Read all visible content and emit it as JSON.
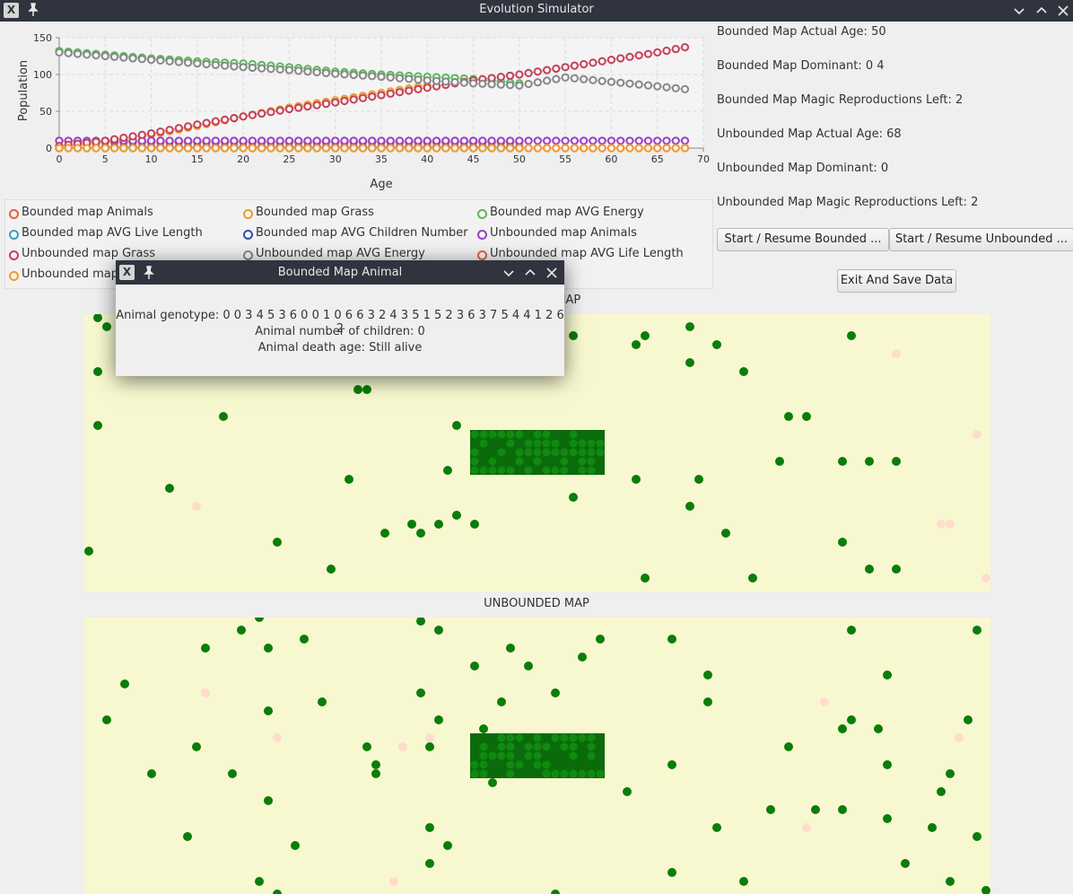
{
  "window": {
    "title": "Evolution Simulator"
  },
  "chart_data": {
    "type": "line",
    "xlabel": "Age",
    "ylabel": "Population",
    "xlim": [
      0,
      70
    ],
    "ylim": [
      0,
      150
    ],
    "x_ticks": [
      0,
      5,
      10,
      15,
      20,
      25,
      30,
      35,
      40,
      45,
      50,
      55,
      60,
      65,
      70
    ],
    "y_ticks": [
      0,
      50,
      100,
      150
    ],
    "grid": true,
    "legend_position": "bottom",
    "series": [
      {
        "name": "Bounded map Animals",
        "color": "#e8613c",
        "x": [
          0,
          2,
          5,
          8,
          10,
          15,
          20,
          25,
          30,
          35,
          40,
          45,
          50
        ],
        "values": [
          10,
          8,
          8,
          8,
          8,
          8,
          8,
          8,
          8,
          8,
          8,
          8,
          8
        ]
      },
      {
        "name": "Bounded map Grass",
        "color": "#f09a30",
        "x": [
          0,
          5,
          10,
          15,
          20,
          25,
          30,
          35,
          40
        ],
        "values": [
          0,
          8,
          18,
          30,
          43,
          55,
          65,
          75,
          85
        ]
      },
      {
        "name": "Bounded map AVG Energy",
        "color": "#5cb85c",
        "x": [
          0,
          5,
          10,
          15,
          20,
          25,
          30,
          35,
          40,
          45,
          50
        ],
        "values": [
          132,
          127,
          122,
          118,
          115,
          110,
          104,
          100,
          97,
          94,
          88
        ]
      },
      {
        "name": "Bounded map AVG Live Length",
        "color": "#3aa0b8",
        "x": [
          0,
          50
        ],
        "values": [
          0,
          0
        ]
      },
      {
        "name": "Bounded map AVG Children Number",
        "color": "#3050b0",
        "x": [
          0,
          5,
          10,
          20,
          30,
          40,
          50
        ],
        "values": [
          0,
          1,
          1,
          1,
          1,
          1,
          1
        ]
      },
      {
        "name": "Unbounded map Animals",
        "color": "#9a40c8",
        "x": [
          0,
          10,
          20,
          30,
          40,
          50,
          60,
          68
        ],
        "values": [
          10,
          10,
          10,
          10,
          10,
          10,
          10,
          10
        ]
      },
      {
        "name": "Unbounded map Grass",
        "color": "#c8405a",
        "x": [
          0,
          5,
          10,
          15,
          20,
          25,
          30,
          35,
          40,
          45,
          50,
          55,
          60,
          65,
          68
        ],
        "values": [
          3,
          10,
          20,
          32,
          43,
          53,
          62,
          72,
          82,
          92,
          100,
          110,
          120,
          130,
          137
        ]
      },
      {
        "name": "Unbounded map AVG Energy",
        "color": "#888888",
        "x": [
          0,
          5,
          10,
          15,
          20,
          25,
          30,
          35,
          40,
          45,
          50,
          55,
          60,
          65,
          68
        ],
        "values": [
          130,
          125,
          120,
          115,
          110,
          106,
          101,
          97,
          92,
          88,
          85,
          96,
          90,
          84,
          80
        ]
      },
      {
        "name": "Unbounded map AVG Life Length",
        "color": "#e8613c",
        "x": [
          0,
          68
        ],
        "values": [
          0,
          0
        ]
      },
      {
        "name": "Unbounded map AVG Children Number",
        "color": "#f09a30",
        "x": [
          0,
          68
        ],
        "values": [
          0,
          0
        ]
      }
    ]
  },
  "legend": {
    "items": [
      {
        "label": "Bounded map Animals",
        "color": "#e8613c"
      },
      {
        "label": "Bounded map Grass",
        "color": "#f09a30"
      },
      {
        "label": "Bounded map AVG Energy",
        "color": "#5cb85c"
      },
      {
        "label": "Bounded map AVG Live Length",
        "color": "#3aa0b8"
      },
      {
        "label": "Bounded map AVG Children Number",
        "color": "#3050b0"
      },
      {
        "label": "Unbounded map Animals",
        "color": "#9a40c8"
      },
      {
        "label": "Unbounded map Grass",
        "color": "#c8405a"
      },
      {
        "label": "Unbounded map AVG Energy",
        "color": "#888888"
      },
      {
        "label": "Unbounded map AVG Life Length",
        "color": "#e8613c"
      },
      {
        "label": "Unbounded map",
        "color": "#f09a30"
      }
    ]
  },
  "stats": {
    "bounded_age": "Bounded Map Actual Age: 50",
    "bounded_dominant": "Bounded Map Dominant: 0 4",
    "bounded_magic": "Bounded Map Magic Reproductions Left: 2",
    "unbounded_age": "Unbounded Map Actual Age: 68",
    "unbounded_dominant": "Unbounded Map Dominant: 0",
    "unbounded_magic": "Unbounded Map Magic Reproductions Left: 2"
  },
  "buttons": {
    "start_bounded": "Start / Resume Bounded ...",
    "start_unbounded": "Start / Resume Unbounded ...",
    "exit_save": "Exit And Save Data"
  },
  "maps": {
    "bounded_title": "BOUNDED MAP",
    "unbounded_title": "UNBOUNDED MAP",
    "colors": {
      "animal": "#0a7d0a",
      "plant": "#ffdccc",
      "jungle": "#0b6b0b",
      "steppe": "#f8f8d0"
    }
  },
  "popup": {
    "title": "Bounded Map Animal",
    "genotype": "Animal genotype: 0 0 3 4 5 3 6 0 0 1 0 6 6 3 2 4 3 5 1 5 2 3 6 3 7 5 4 4 1 2 6 2",
    "children": "Animal number of children: 0",
    "death_age": "Animal death age: Still alive"
  }
}
